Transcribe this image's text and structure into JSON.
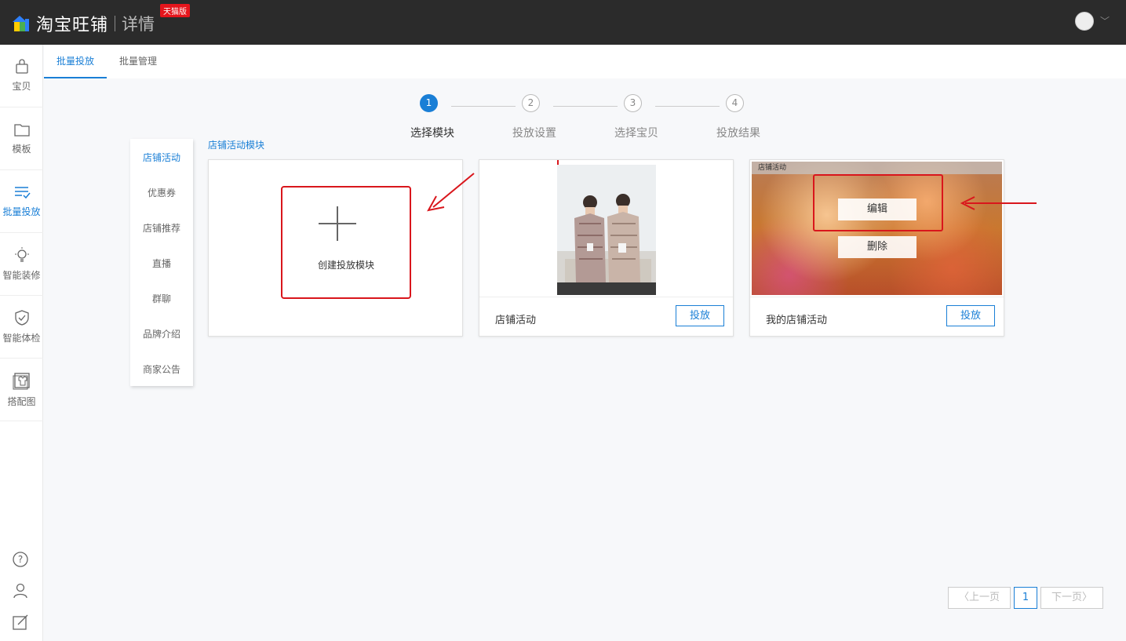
{
  "header": {
    "brand": "淘宝旺铺",
    "page": "详情",
    "badge": "天猫版"
  },
  "leftnav": {
    "items": [
      {
        "label": "宝贝",
        "icon": "bag-icon"
      },
      {
        "label": "模板",
        "icon": "folder-icon"
      },
      {
        "label": "批量投放",
        "icon": "list-check-icon",
        "active": true
      },
      {
        "label": "智能装修",
        "icon": "lightbulb-icon"
      },
      {
        "label": "智能体检",
        "icon": "shield-check-icon"
      },
      {
        "label": "搭配图",
        "icon": "shirt-frame-icon"
      }
    ]
  },
  "tabs": [
    {
      "label": "批量投放",
      "active": true
    },
    {
      "label": "批量管理",
      "active": false
    }
  ],
  "steps": [
    {
      "num": "1",
      "label": "选择模块",
      "active": true
    },
    {
      "num": "2",
      "label": "投放设置",
      "active": false
    },
    {
      "num": "3",
      "label": "选择宝贝",
      "active": false
    },
    {
      "num": "4",
      "label": "投放结果",
      "active": false
    }
  ],
  "categories": [
    {
      "label": "店铺活动",
      "active": true
    },
    {
      "label": "优惠券"
    },
    {
      "label": "店铺推荐"
    },
    {
      "label": "直播"
    },
    {
      "label": "群聊"
    },
    {
      "label": "品牌介绍"
    },
    {
      "label": "商家公告"
    }
  ],
  "section_title": "店铺活动模块",
  "cards": {
    "create_label": "创建投放模块",
    "card2_title": "店铺活动",
    "card3_title": "我的店铺活动",
    "card3_preview_label": "店铺活动",
    "deploy_label": "投放",
    "edit_label": "编辑",
    "delete_label": "删除"
  },
  "pager": {
    "prev": "上一页",
    "current": "1",
    "next": "下一页"
  },
  "colors": {
    "accent": "#1a7fd6",
    "annotation_red": "#d9161c",
    "topbar": "#2b2b2b"
  }
}
